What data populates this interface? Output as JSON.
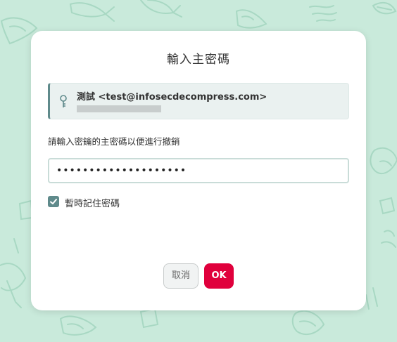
{
  "dialog": {
    "title": "輸入主密碼",
    "account": {
      "name": "測試 <test@infosecdecompress.com>",
      "icon": "key-icon"
    },
    "instruction": "請輸入密鑰的主密碼以便進行撤銷",
    "password": {
      "value": "••••••••••••••••••••"
    },
    "remember": {
      "label": "暫時記住密碼",
      "checked": true
    },
    "buttons": {
      "cancel_label": "取消",
      "ok_label": "OK"
    }
  },
  "colors": {
    "background": "#c9eadb",
    "doodle": "#a8d8c3",
    "accent": "#5f8a8b",
    "ok_button": "#e0003c"
  }
}
